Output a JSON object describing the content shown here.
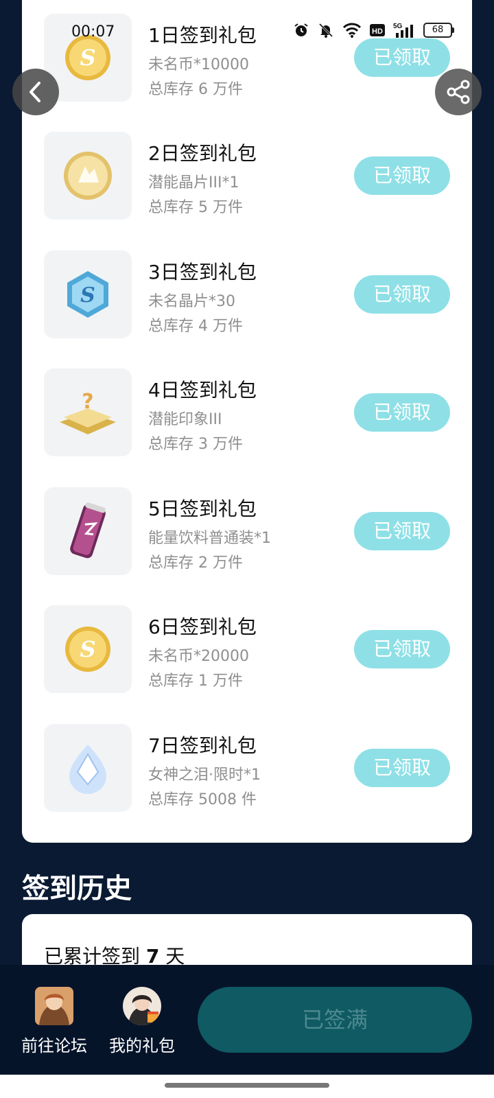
{
  "status_bar": {
    "time": "00:07",
    "battery": "68"
  },
  "gifts": [
    {
      "title": "1日签到礼包",
      "item": "未名币*10000",
      "stock": "总库存 6 万件",
      "button": "已领取",
      "icon": "gold-coin-icon"
    },
    {
      "title": "2日签到礼包",
      "item": "潜能晶片III*1",
      "stock": "总库存 5 万件",
      "button": "已领取",
      "icon": "potential-chip-icon"
    },
    {
      "title": "3日签到礼包",
      "item": "未名晶片*30",
      "stock": "总库存 4 万件",
      "button": "已领取",
      "icon": "blue-hex-crystal-icon"
    },
    {
      "title": "4日签到礼包",
      "item": "潜能印象III",
      "stock": "总库存 3 万件",
      "button": "已领取",
      "icon": "mystery-platform-icon"
    },
    {
      "title": "5日签到礼包",
      "item": "能量饮料普通装*1",
      "stock": "总库存 2 万件",
      "button": "已领取",
      "icon": "energy-drink-icon"
    },
    {
      "title": "6日签到礼包",
      "item": "未名币*20000",
      "stock": "总库存 1 万件",
      "button": "已领取",
      "icon": "gold-coin-icon"
    },
    {
      "title": "7日签到礼包",
      "item": "女神之泪·限时*1",
      "stock": "总库存 5008 件",
      "button": "已领取",
      "icon": "goddess-tear-gem-icon"
    }
  ],
  "history": {
    "heading": "签到历史",
    "total_prefix": "已累计签到 ",
    "total_days": "7",
    "total_suffix": " 天"
  },
  "bottom_bar": {
    "forum_label": "前往论坛",
    "my_gifts_label": "我的礼包",
    "signed_button": "已签满"
  },
  "colors": {
    "background": "#0a1a33",
    "claim_button": "#8ee0e6",
    "signed_button": "#0f5a63"
  }
}
